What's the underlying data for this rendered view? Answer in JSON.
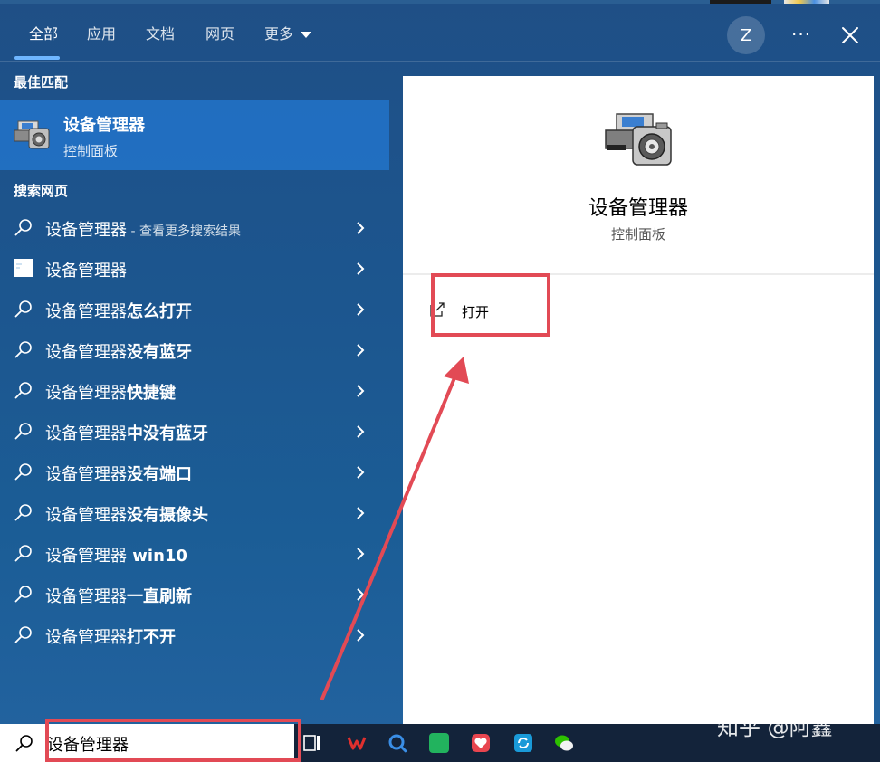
{
  "tabs": [
    {
      "label": "全部"
    },
    {
      "label": "应用"
    },
    {
      "label": "文档"
    },
    {
      "label": "网页"
    },
    {
      "label": "更多"
    }
  ],
  "user": {
    "avatar_initial": "Z"
  },
  "header": {
    "more_label": "···"
  },
  "best_match": {
    "section_label": "最佳匹配",
    "title": "设备管理器",
    "subtitle": "控制面板"
  },
  "web": {
    "section_label": "搜索网页",
    "results": [
      {
        "prefix": "设备管理器",
        "bold": "",
        "hint": " - 查看更多搜索结果"
      },
      {
        "prefix": "设备管理器",
        "bold": "",
        "hint": ""
      },
      {
        "prefix": "设备管理器",
        "bold": "怎么打开",
        "hint": ""
      },
      {
        "prefix": "设备管理器",
        "bold": "没有蓝牙",
        "hint": ""
      },
      {
        "prefix": "设备管理器",
        "bold": "快捷键",
        "hint": ""
      },
      {
        "prefix": "设备管理器",
        "bold": "中没有蓝牙",
        "hint": ""
      },
      {
        "prefix": "设备管理器",
        "bold": "没有端口",
        "hint": ""
      },
      {
        "prefix": "设备管理器",
        "bold": "没有摄像头",
        "hint": ""
      },
      {
        "prefix": "设备管理器",
        "bold": " win10",
        "hint": ""
      },
      {
        "prefix": "设备管理器",
        "bold": "一直刷新",
        "hint": ""
      },
      {
        "prefix": "设备管理器",
        "bold": "打不开",
        "hint": ""
      }
    ]
  },
  "detail": {
    "title": "设备管理器",
    "subtitle": "控制面板",
    "open_label": "打开"
  },
  "search": {
    "value": "设备管理器"
  },
  "watermark": "知乎 @阿鑫",
  "colors": {
    "accent": "#6fb6ff",
    "highlight_box": "#e24a55",
    "selection": "#2378d2"
  }
}
